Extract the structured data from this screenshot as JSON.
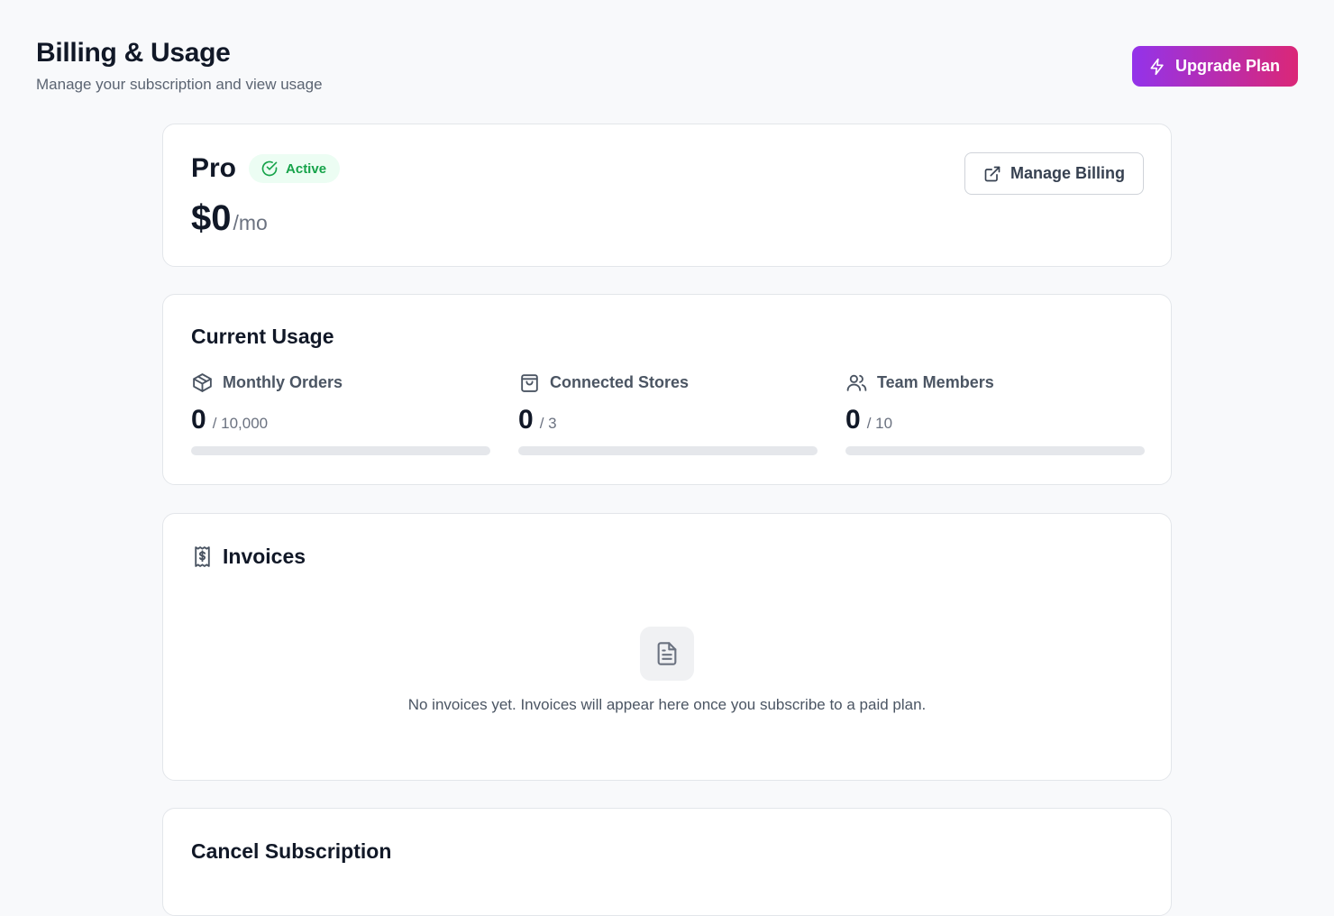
{
  "header": {
    "title": "Billing & Usage",
    "subtitle": "Manage your subscription and view usage",
    "upgrade_label": "Upgrade Plan"
  },
  "plan": {
    "name": "Pro",
    "status": "Active",
    "price": "$0",
    "period": "/mo",
    "manage_label": "Manage Billing"
  },
  "usage": {
    "title": "Current Usage",
    "items": [
      {
        "label": "Monthly Orders",
        "used": "0",
        "limit": "/ 10,000",
        "fraction": 0,
        "icon": "package-icon"
      },
      {
        "label": "Connected Stores",
        "used": "0",
        "limit": "/ 3",
        "fraction": 0,
        "icon": "shopping-bag-icon"
      },
      {
        "label": "Team Members",
        "used": "0",
        "limit": "/ 10",
        "fraction": 0,
        "icon": "users-icon"
      }
    ]
  },
  "invoices": {
    "title": "Invoices",
    "empty_text": "No invoices yet. Invoices will appear here once you subscribe to a paid plan."
  },
  "cancel": {
    "title": "Cancel Subscription"
  },
  "colors": {
    "accent_start": "#9333ea",
    "accent_end": "#db2777",
    "active_green": "#16a34a",
    "progress_track": "#e5e7eb"
  }
}
